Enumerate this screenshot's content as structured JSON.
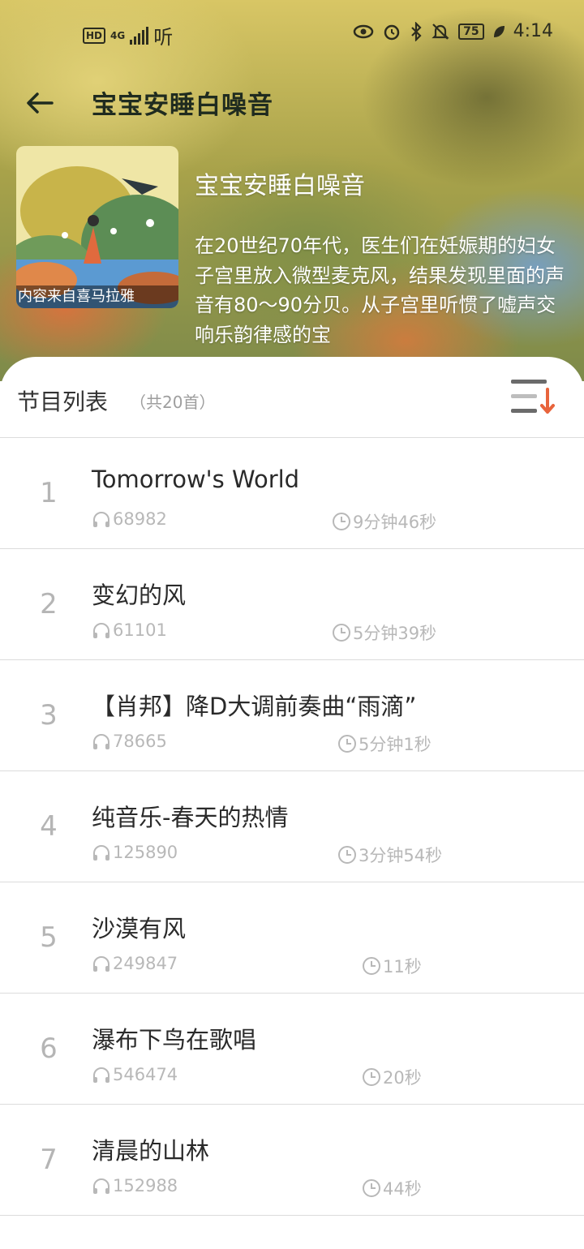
{
  "status_bar": {
    "hd": "HD",
    "network": "4G",
    "app_tag": "听",
    "battery": "75",
    "time": "4:14"
  },
  "header": {
    "title": "宝宝安睡白噪音"
  },
  "album": {
    "cover_caption": "内容来自喜马拉雅",
    "title": "宝宝安睡白噪音",
    "description": "在20世纪70年代，医生们在妊娠期的妇女子宫里放入微型麦克风，结果发现里面的声音有80～90分贝。从子宫里听惯了嘘声交响乐韵律感的宝"
  },
  "list": {
    "title": "节目列表",
    "count": "（共20首）",
    "tracks": [
      {
        "num": "1",
        "title": "Tomorrow's World",
        "plays": "68982",
        "duration": "9分钟46秒"
      },
      {
        "num": "2",
        "title": "变幻的风",
        "plays": "61101",
        "duration": "5分钟39秒"
      },
      {
        "num": "3",
        "title": "【肖邦】降D大调前奏曲“雨滴”",
        "plays": "78665",
        "duration": "5分钟1秒"
      },
      {
        "num": "4",
        "title": "纯音乐-春天的热情",
        "plays": "125890",
        "duration": "3分钟54秒"
      },
      {
        "num": "5",
        "title": "沙漠有风",
        "plays": "249847",
        "duration": "11秒"
      },
      {
        "num": "6",
        "title": "瀑布下鸟在歌唱",
        "plays": "546474",
        "duration": "20秒"
      },
      {
        "num": "7",
        "title": "清晨的山林",
        "plays": "152988",
        "duration": "44秒"
      }
    ]
  },
  "colors": {
    "accent": "#e8643c",
    "muted_text": "#b8b8b8",
    "divider": "#dcdcdc"
  }
}
